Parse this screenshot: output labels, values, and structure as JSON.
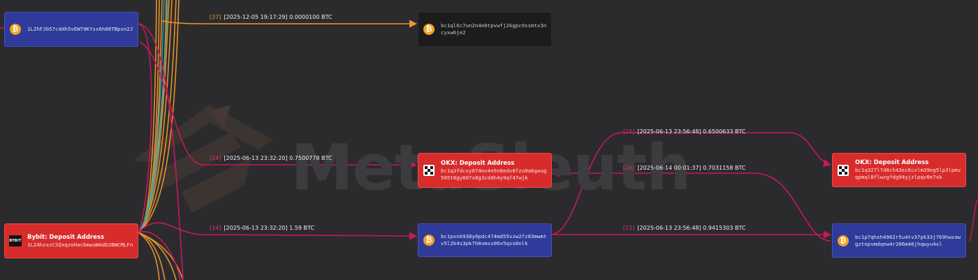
{
  "watermark": {
    "text": "MetaSleuth"
  },
  "nodes": [
    {
      "id": "n1",
      "kind": "btc",
      "color": "blue",
      "title": "",
      "address": "1LZhFJb57cAHh5vEW79KYsx6h88TBpxn2J"
    },
    {
      "id": "n2",
      "kind": "btc",
      "color": "dark",
      "title": "",
      "address": "bc1ql6c7un2n4e0tpvwfj2kgpc0ssmtx3ncyxw6je2"
    },
    {
      "id": "n3",
      "kind": "okx",
      "color": "red",
      "title": "OKX: Deposit Address",
      "address": "bc1q3fdcsy074ex4n9s0edx0fzu9a6gaug505t8gy607x8g3cddh4y9qf47wjk"
    },
    {
      "id": "n4",
      "kind": "bybit",
      "color": "red",
      "title": "Bybit: Deposit Address",
      "address": "1L24hzxzCSQxqzoHacbmwuWAdD2BWCMLFn"
    },
    {
      "id": "n5",
      "kind": "btc",
      "color": "blue",
      "title": "",
      "address": "bc1psnk938y0pdc474md55vzw2fz83mwmtv5l2k4s3pk7h0vmsx06v5qss8nlk"
    },
    {
      "id": "n6",
      "kind": "okx",
      "color": "red",
      "title": "OKX: Deposit Address",
      "address": "bc1q327l7d8ch43ec6cxlm39eg5lp3lpmvqpmql8flwzgfdg94yjzlpqv0e7sk"
    },
    {
      "id": "n7",
      "kind": "btc",
      "color": "blue",
      "title": "",
      "address": "bc1p7qhxh4962r5u4tv37pk33j769hwzawgztnpvmdqew4r206m46jhqwyu4xl"
    }
  ],
  "edge_labels": [
    {
      "id": "e1",
      "index": "[37]",
      "index_color": "orange",
      "text": "[2025-12-05 19:17:29] 0.0000100 BTC"
    },
    {
      "id": "e2",
      "index": "[14]",
      "index_color": "pink",
      "text": "[2025-06-13 23:32:20] 0.7500778 BTC"
    },
    {
      "id": "e3",
      "index": "[14]",
      "index_color": "pink",
      "text": "[2025-06-13 23:32:20] 1.59 BTC"
    },
    {
      "id": "e4",
      "index": "[15]",
      "index_color": "pink",
      "text": "[2025-06-13 23:56:48] 0.6500633 BTC"
    },
    {
      "id": "e5",
      "index": "[16]",
      "index_color": "pink",
      "text": "[2025-06-14 00:01:37] 0.7031158 BTC"
    },
    {
      "id": "e6",
      "index": "[15]",
      "index_color": "pink",
      "text": "[2025-06-13 23:56:48] 0.9415303 BTC"
    }
  ],
  "icons": {
    "btc": "bitcoin-icon",
    "okx": "okx-logo-icon",
    "bybit": "bybit-logo-icon"
  },
  "bybit_logo_text": "BYBIT",
  "colors": {
    "background": "#2b2b2e",
    "edge_pink": "#c8185a",
    "edge_orange": "#f0962a",
    "node_blue": "#2f3a9a",
    "node_red": "#d82c2c",
    "node_dark": "#1c1c1e",
    "btc_orange": "#f3a11f"
  }
}
